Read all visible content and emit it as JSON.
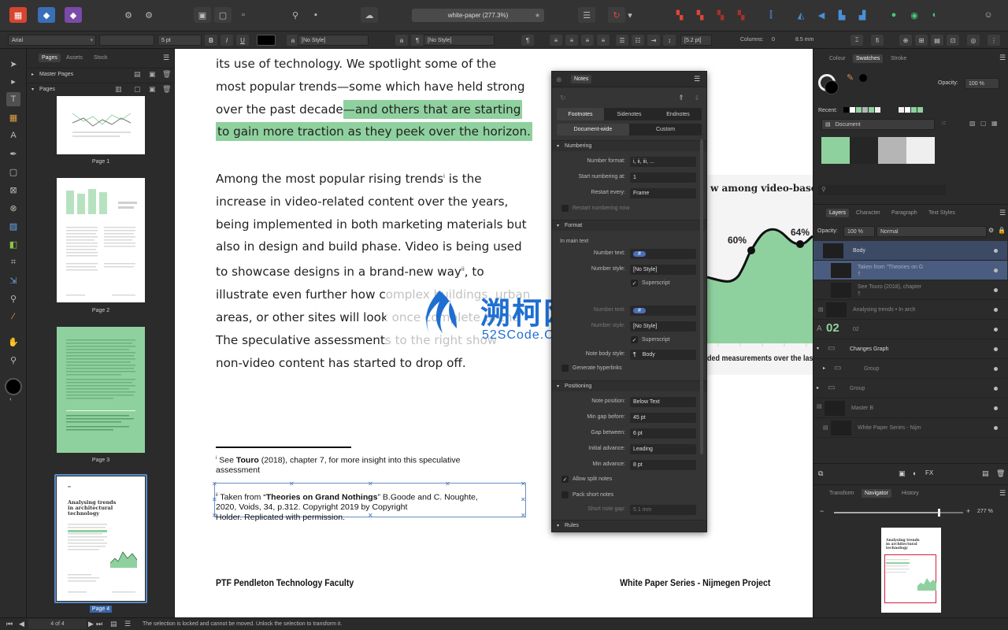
{
  "toolbar": {
    "doc_title": "white-paper (277.3%)"
  },
  "context_bar": {
    "font": "Arial",
    "font_style": "",
    "font_size": "5 pt",
    "para_style": "[No Style]",
    "char_style": "[No Style]",
    "leading": "[5.2 pt]",
    "columns_label": "Columns:",
    "columns_value": "0",
    "gutter": "8.5 mm"
  },
  "pages_panel": {
    "tabs": [
      "Pages",
      "Assets",
      "Stock"
    ],
    "master_pages": "Master Pages",
    "pages": "Pages",
    "page_labels": [
      "Page 1",
      "Page 2",
      "Page 3",
      "Page 4"
    ],
    "thumb4_title": "Analysing trends in architectural technology"
  },
  "document": {
    "para1": [
      "its use of technology. We spotlight some of the",
      "most popular trends—some which have held strong",
      "over the past decade",
      "—and others that are starting",
      "to gain more traction as they peek over the horizon."
    ],
    "para2": [
      "Among the most popular rising trends",
      "i",
      " is the",
      "increase in video-related content over the years,",
      "being implemented in both marketing materials but",
      "also in design and build phase. Video is being used",
      "to showcase designs in a brand-new way",
      "ii",
      ", to",
      "illustrate even further how complex buildings, urban",
      "areas, or other sites will look once complete to the",
      "The speculative assessments to the right show",
      "non-video content has started to drop off."
    ],
    "footnote1": {
      "mark": "i",
      "pre": " See ",
      "bold": "Touro",
      "post": " (2018), chapter 7, for more insight into this speculative",
      "line2": "assessment"
    },
    "footnote2": {
      "mark": "ii",
      "pre": " Taken from “",
      "bold": "Theories on Grand Nothings",
      "post": "” B.Goode and C. Noughte,",
      "line2": "2020, Voids, 34, p.312. Copyright 2019 by Copyright",
      "line3": "Holder. Replicated with permission."
    },
    "footer_left": "PTF Pendleton Technology Faculty",
    "footer_right": "White Paper Series - Nijmegen Project",
    "chart_title": "w among video-based",
    "chart_label1": "60%",
    "chart_label2": "64%",
    "chart_caption": "ded measurements over the las"
  },
  "watermark": {
    "cn": "溯柯网",
    "url": "52SCode.CoM"
  },
  "notes_panel": {
    "title": "Notes",
    "tabs": [
      "Footnotes",
      "Sidenotes",
      "Endnotes"
    ],
    "subtabs": [
      "Document-wide",
      "Custom"
    ],
    "sections": [
      "Numbering",
      "Format",
      "Positioning",
      "Rules"
    ],
    "number_format_label": "Number format:",
    "number_format": "i, ii, iii, ...",
    "start_label": "Start numbering at:",
    "start_value": "1",
    "restart_label": "Restart every:",
    "restart_value": "Frame",
    "restart_now": "Restart numbering now",
    "in_main_text": "In main text",
    "number_text_label": "Number text:",
    "number_text_value": "#",
    "number_style_label": "Number style:",
    "number_style_value": "[No Style]",
    "superscript": "Superscript",
    "note_body_label": "Note body style:",
    "note_body_value": "Body",
    "generate_hyperlinks": "Generate hyperlinks",
    "note_position_label": "Note position:",
    "note_position_value": "Below Text",
    "min_gap_label": "Min gap before:",
    "min_gap_value": "45 pt",
    "gap_label": "Gap between:",
    "gap_value": "6 pt",
    "initial_adv_label": "Initial advance:",
    "initial_adv_value": "Leading",
    "min_adv_label": "Min advance:",
    "min_adv_value": "8 pt",
    "allow_split": "Allow split notes",
    "pack_short": "Pack short notes",
    "short_gap_label": "Short note gap:",
    "short_gap_value": "5.1 mm"
  },
  "swatches_panel": {
    "tabs": [
      "Colour",
      "Swatches",
      "Stroke"
    ],
    "opacity_label": "Opacity:",
    "opacity_value": "100 %",
    "recent_label": "Recent:",
    "palette": "Document",
    "colors": [
      "#8fd19e",
      "#262626",
      "#b5b5b5",
      "#efefef"
    ]
  },
  "layers_panel": {
    "tabs": [
      "Layers",
      "Character",
      "Paragraph",
      "Text Styles"
    ],
    "opacity_label": "Opacity:",
    "opacity_value": "100 %",
    "blend": "Normal",
    "layers": [
      {
        "name": "Body"
      },
      {
        "name": "Taken from “Theories on G"
      },
      {
        "name": "See Touro (2018), chapter"
      },
      {
        "name": "Analysing trends • In arch"
      },
      {
        "name": "02"
      },
      {
        "name": "Changes Graph"
      },
      {
        "name": "Group"
      },
      {
        "name": "Group"
      },
      {
        "name": "Master B"
      },
      {
        "name": "White Paper Series - Nijm"
      }
    ],
    "big_label": "02"
  },
  "navigator_panel": {
    "tabs": [
      "Transform",
      "Navigator",
      "History"
    ],
    "zoom": "277 %",
    "thumb_title": "Analysing trends in architectural technology"
  },
  "status": {
    "page_indicator": "4 of 4",
    "message": "The selection is locked and cannot be moved. Unlock the selection to transform it."
  }
}
